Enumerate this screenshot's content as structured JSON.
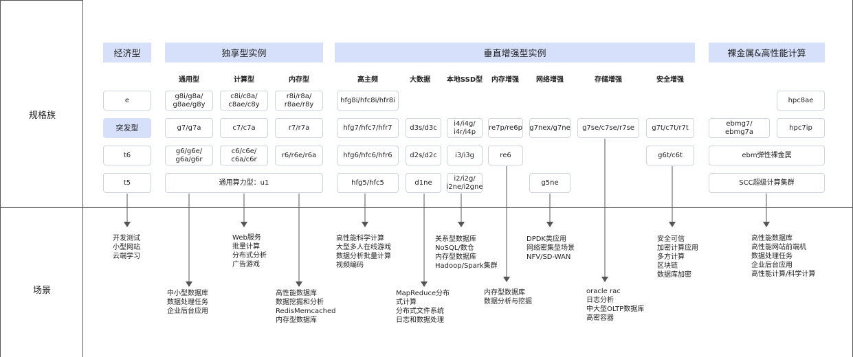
{
  "row_labels": {
    "spec_family": "规格族",
    "scenario": "场景"
  },
  "categories": {
    "economy": "经济型",
    "dedicated": "独享型实例",
    "vertical": "垂直增强型实例",
    "baremetal": "裸金属&高性能计算"
  },
  "subcategories": {
    "general": "通用型",
    "compute": "计算型",
    "memory": "内存型",
    "high_freq": "高主频",
    "big_data": "大数据",
    "local_ssd": "本地SSD型",
    "mem_enh": "内存增强",
    "net_enh": "网络增强",
    "storage_enh": "存储增强",
    "security_enh": "安全增强"
  },
  "families": {
    "e": "e",
    "burstable": "突发型",
    "t6": "t6",
    "t5": "t5",
    "g8i": "g8i/g8a/\ng8ae/g8y",
    "c8i": "c8i/c8a/\nc8ae/c8y",
    "r8i": "r8i/r8a/\nr8ae/r8y",
    "g7": "g7/g7a",
    "c7": "c7/c7a",
    "r7": "r7/r7a",
    "g6": "g6/g6e/\ng6a/g6r",
    "c6": "c6/c6e/\nc6a/c6r",
    "r6": "r6/r6e/r6a",
    "u1": "通用算力型：u1",
    "hfg8i": "hfg8i/hfc8i/hfr8i",
    "hfg7": "hfg7/hfc7/hfr7",
    "hfg6": "hfg6/hfc6/hfr6",
    "hfg5": "hfg5/hfc5",
    "d3s": "d3s/d3c",
    "d2s": "d2s/d2c",
    "d1ne": "d1ne",
    "i4": "i4/i4g/\ni4r/i4p",
    "i3": "i3/i3g",
    "i2": "i2/i2g/\ni2ne/i2gne",
    "re7p": "re7p/re6p",
    "re6": "re6",
    "g7nex": "g7nex/g7ne",
    "g5ne": "g5ne",
    "g7se": "g7se/c7se/r7se",
    "g7t": "g7t/c7t/r7t",
    "g6t": "g6t/c6t",
    "hpc8ae": "hpc8ae",
    "ebmg7": "ebmg7/\nebmg7a",
    "hpc7ip": "hpc7ip",
    "ebm": "ebm弹性裸金属",
    "scc": "SCC超级计算集群"
  },
  "scenarios": {
    "economy": "开发测试\n小型网站\n云端学习",
    "general": "中小型数据库\n数据处理任务\n企业后台应用",
    "compute": "Web服务\n批量计算\n分布式分析\n广告游戏",
    "memory": "高性能数据库\n数据挖掘和分析\nRedisMemcached\n内存型数据库",
    "high_freq": "高性能科学计算\n大型多人在线游戏\n数据分析批量计算\n视频编码",
    "big_data": "MapReduce分布\n式计算\n分布式文件系统\n日志和数据处理",
    "local_ssd": "关系型数据库\nNoSQL/数仓\n内存型数据库\nHadoop/Spark集群",
    "mem_enh": "内存型数据库\n数据分析与挖掘",
    "net_enh": "DPDK类应用\n网络密集型场景\nNFV/SD-WAN",
    "storage_enh": "oracle rac\n日志分析\n中大型OLTP数据库\n高密容器",
    "security_enh": "安全可信\n加密计算应用\n多方计算\n区块链\n数据库加密",
    "baremetal": "高性能数据库\n高性能网站前端机\n数据处理任务\n企业后台应用\n高性能计算/科学计算"
  },
  "colors": {
    "header_bg": "#d6e0fb",
    "border": "#cfd3dc",
    "line": "#555555"
  }
}
